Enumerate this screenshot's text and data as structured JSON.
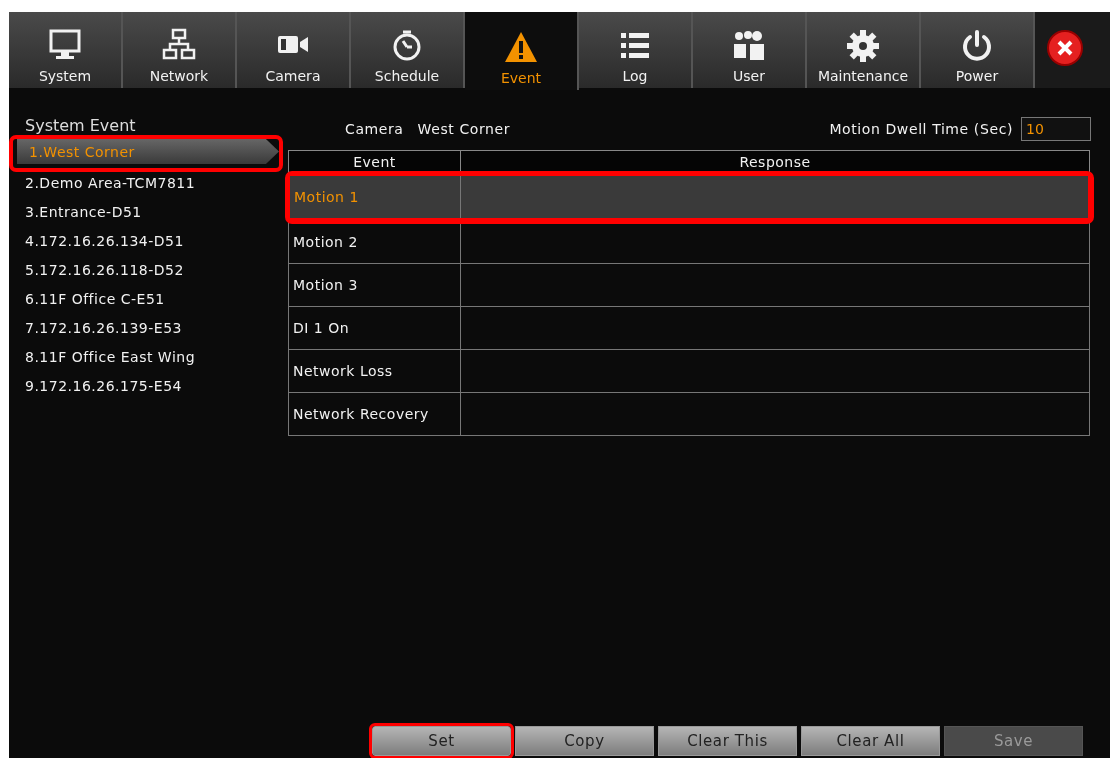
{
  "tabs": [
    {
      "label": "System",
      "selected": false
    },
    {
      "label": "Network",
      "selected": false
    },
    {
      "label": "Camera",
      "selected": false
    },
    {
      "label": "Schedule",
      "selected": false
    },
    {
      "label": "Event",
      "selected": true
    },
    {
      "label": "Log",
      "selected": false
    },
    {
      "label": "User",
      "selected": false
    },
    {
      "label": "Maintenance",
      "selected": false
    },
    {
      "label": "Power",
      "selected": false
    }
  ],
  "sidebar": {
    "title": "System Event",
    "items": [
      {
        "label": "1.West Corner",
        "selected": true,
        "highlighted": true
      },
      {
        "label": "2.Demo Area-TCM7811",
        "selected": false,
        "highlighted": false
      },
      {
        "label": "3.Entrance-D51",
        "selected": false,
        "highlighted": false
      },
      {
        "label": "4.172.16.26.134-D51",
        "selected": false,
        "highlighted": false
      },
      {
        "label": "5.172.16.26.118-D52",
        "selected": false,
        "highlighted": false
      },
      {
        "label": "6.11F Office C-E51",
        "selected": false,
        "highlighted": false
      },
      {
        "label": "7.172.16.26.139-E53",
        "selected": false,
        "highlighted": false
      },
      {
        "label": "8.11F Office East Wing",
        "selected": false,
        "highlighted": false
      },
      {
        "label": "9.172.16.26.175-E54",
        "selected": false,
        "highlighted": false
      }
    ]
  },
  "camera": {
    "label": "Camera",
    "value": "West Corner"
  },
  "dwell_time": {
    "label": "Motion Dwell Time (Sec)",
    "value": "10"
  },
  "table": {
    "columns": [
      "Event",
      "Response"
    ],
    "rows": [
      {
        "event": "Motion 1",
        "selected": true,
        "highlighted": true
      },
      {
        "event": "Motion 2",
        "selected": false,
        "highlighted": false
      },
      {
        "event": "Motion 3",
        "selected": false,
        "highlighted": false
      },
      {
        "event": "DI 1 On",
        "selected": false,
        "highlighted": false
      },
      {
        "event": "Network Loss",
        "selected": false,
        "highlighted": false
      },
      {
        "event": "Network Recovery",
        "selected": false,
        "highlighted": false
      }
    ]
  },
  "buttons": [
    {
      "label": "Set",
      "disabled": false,
      "highlighted": true
    },
    {
      "label": "Copy",
      "disabled": false,
      "highlighted": false
    },
    {
      "label": "Clear This",
      "disabled": false,
      "highlighted": false
    },
    {
      "label": "Clear All",
      "disabled": false,
      "highlighted": false
    },
    {
      "label": "Save",
      "disabled": true,
      "highlighted": false
    }
  ]
}
